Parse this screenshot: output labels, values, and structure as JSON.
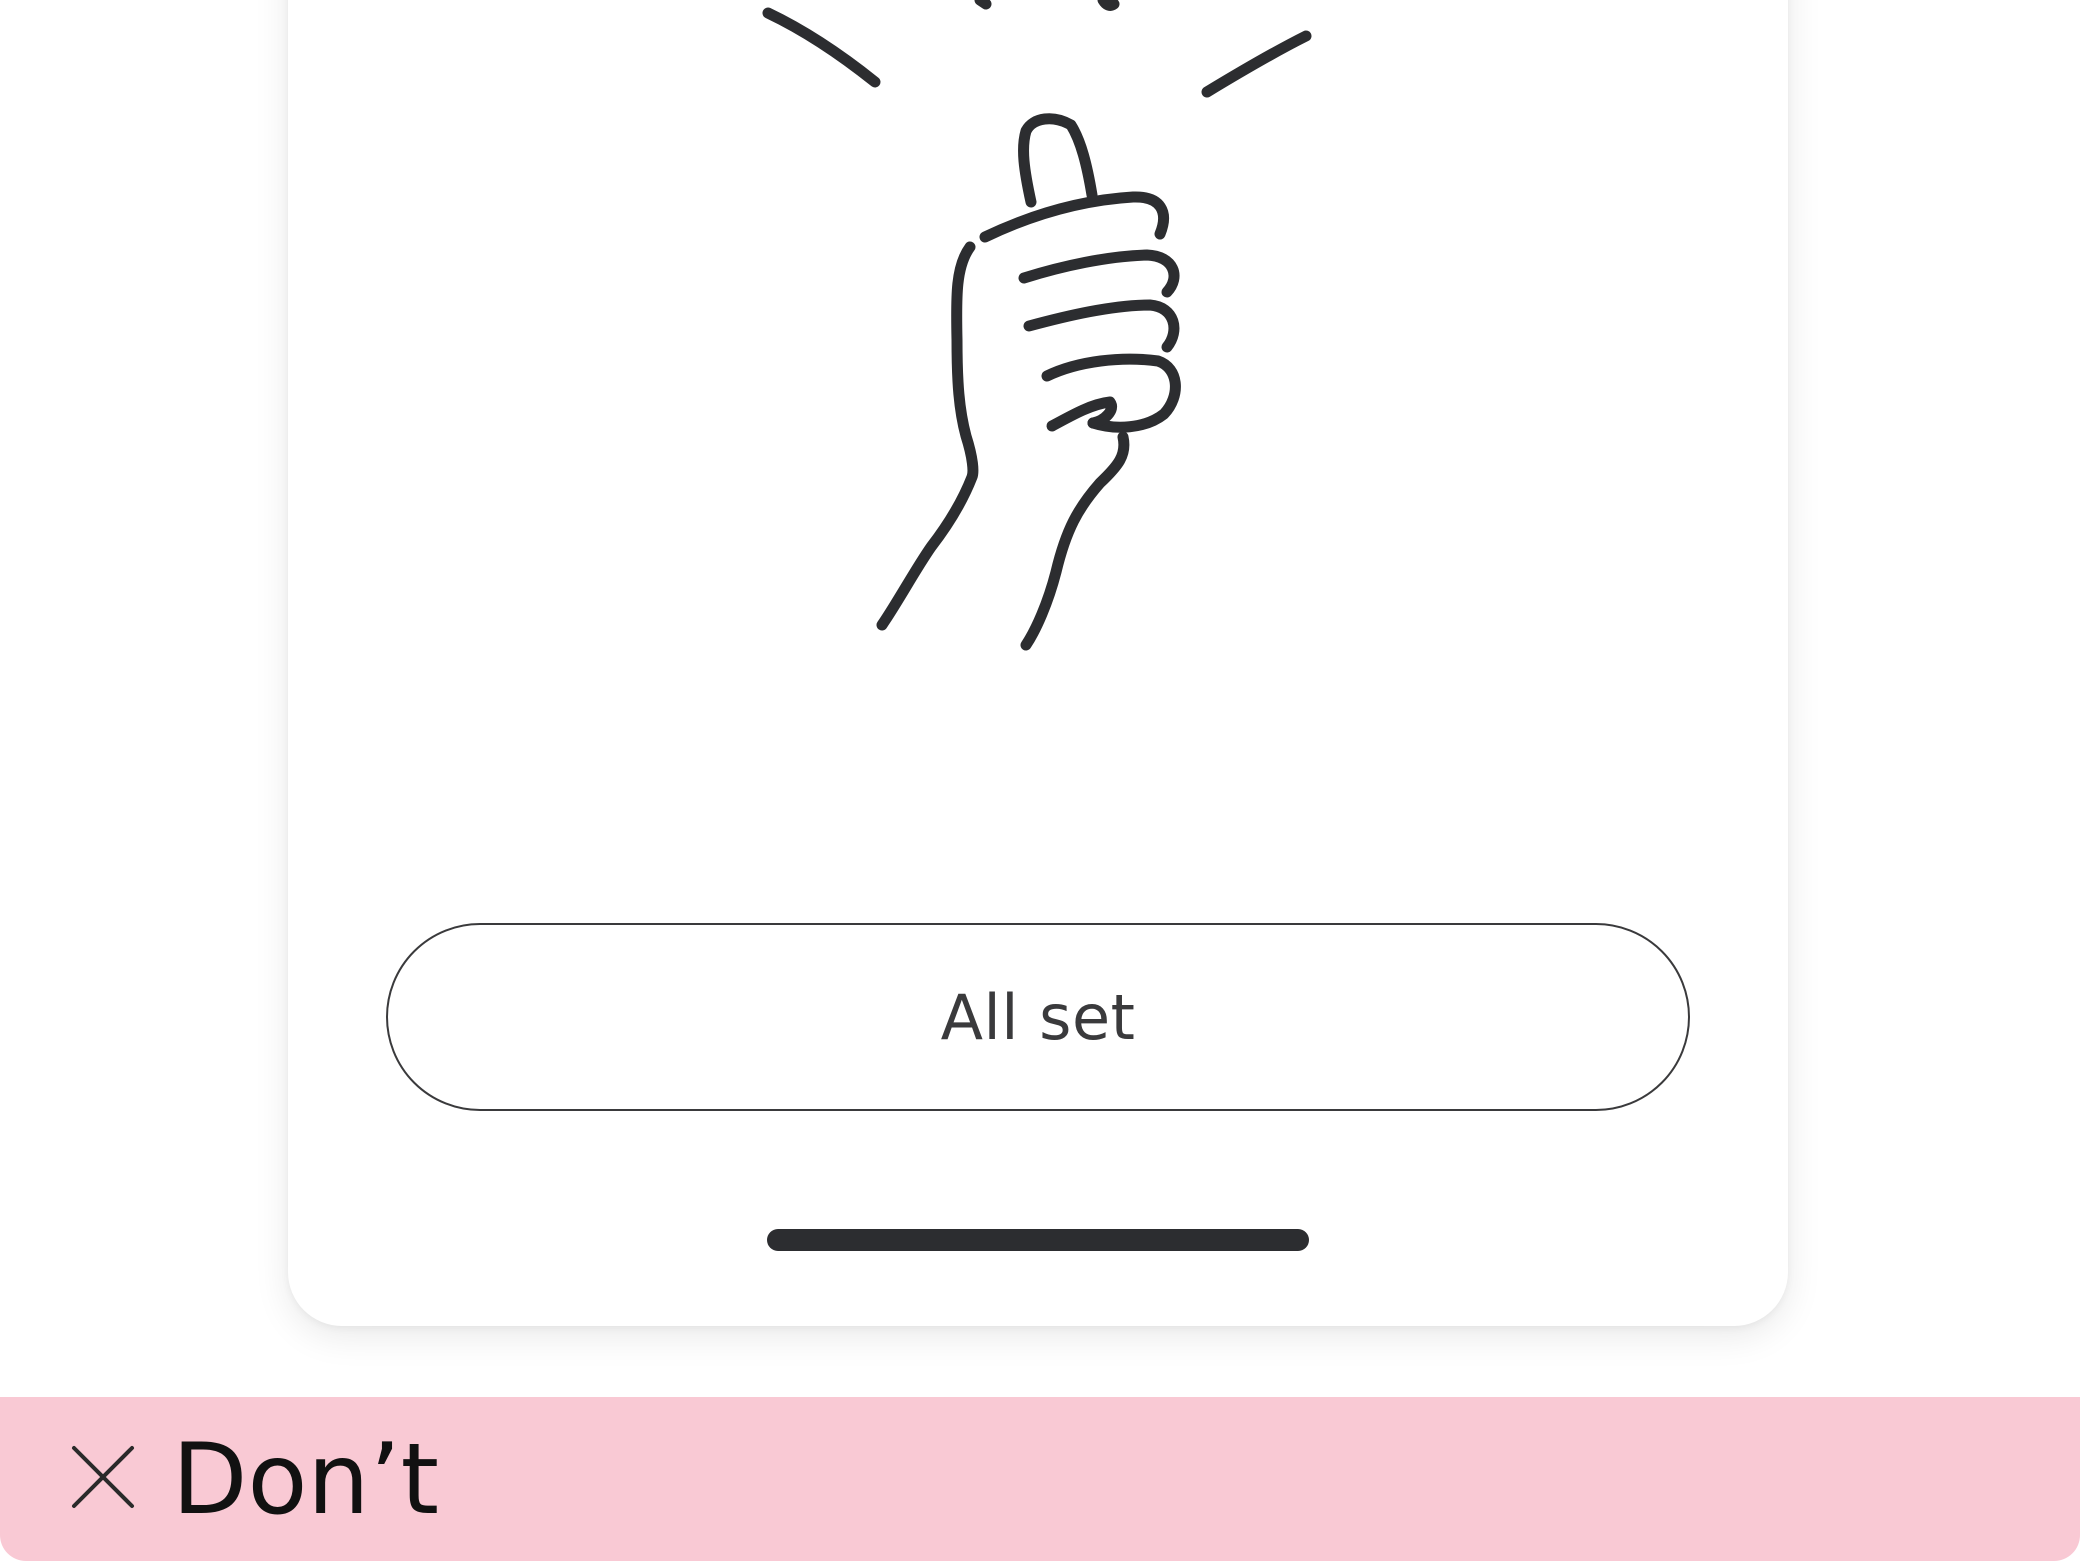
{
  "illustration": {
    "icon": "thumbs-up-hand-icon",
    "stroke_color": "#2c2d30"
  },
  "cta": {
    "label": "All set"
  },
  "home_indicator": {
    "color": "#2c2d30"
  },
  "footer": {
    "icon": "close-x-icon",
    "label": "Don’t",
    "background_color": "#f9c9d4"
  }
}
